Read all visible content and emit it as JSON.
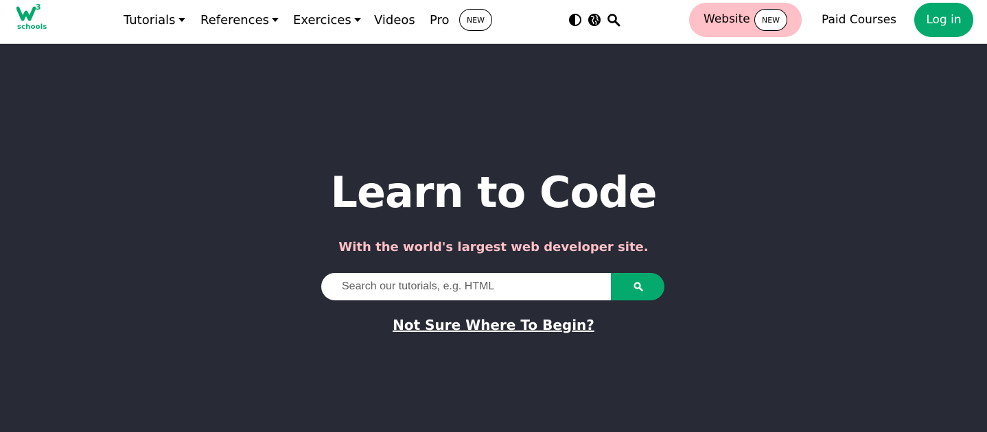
{
  "logo": {
    "text": "schools",
    "superscript": "3",
    "icon": "w3schools-logo"
  },
  "nav": {
    "items": [
      {
        "label": "Tutorials",
        "has_caret": true
      },
      {
        "label": "References",
        "has_caret": true
      },
      {
        "label": "Exercices",
        "has_caret": true
      },
      {
        "label": "Videos",
        "has_caret": false
      },
      {
        "label": "Pro",
        "has_caret": false
      }
    ],
    "pro_badge": "NEW",
    "icons": [
      "contrast-icon",
      "globe-icon",
      "search-icon"
    ]
  },
  "website_button": {
    "label": "Website",
    "badge": "NEW"
  },
  "paid_courses": "Paid Courses",
  "login": "Log in",
  "hero": {
    "title": "Learn to Code",
    "subtitle": "With the world's largest web developer site.",
    "search_placeholder": "Search our tutorials, e.g. HTML",
    "link": "Not Sure Where To Begin?"
  },
  "colors": {
    "accent": "#04AA6D",
    "pink": "#FFC0C7",
    "hero_bg": "#282A35"
  }
}
